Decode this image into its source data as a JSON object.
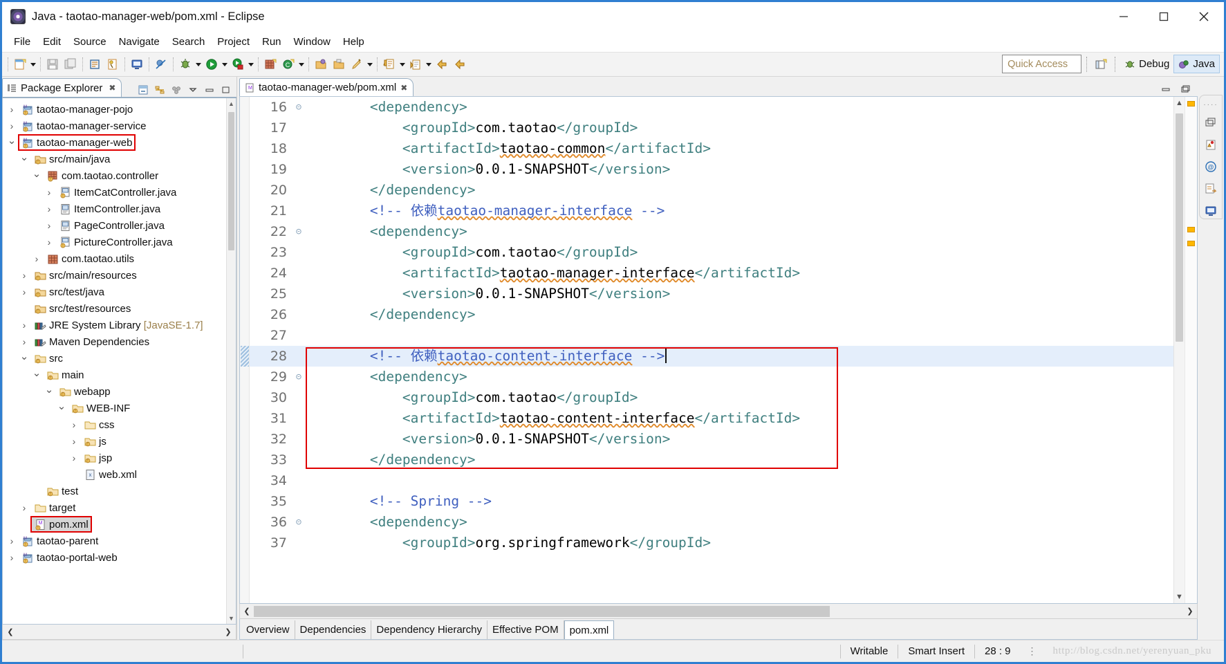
{
  "window": {
    "title": "Java - taotao-manager-web/pom.xml - Eclipse",
    "app_icon": "eclipse-icon",
    "minimize_label": "Minimize",
    "maximize_label": "Maximize",
    "close_label": "Close"
  },
  "menubar": {
    "items": [
      "File",
      "Edit",
      "Source",
      "Navigate",
      "Search",
      "Project",
      "Run",
      "Window",
      "Help"
    ]
  },
  "toolbar": {
    "quick_access_placeholder": "Quick Access",
    "perspectives": [
      {
        "label": "Debug",
        "icon": "debug-bug-icon",
        "active": false
      },
      {
        "label": "Java",
        "icon": "java-perspective-icon",
        "active": true
      }
    ],
    "open_perspective_icon": "open-perspective-icon",
    "groups": [
      {
        "icons": [
          "new-wizard-icon",
          "dropdown-caret"
        ]
      },
      {
        "icons": [
          "save-icon",
          "save-all-icon"
        ]
      },
      {
        "icons": [
          "print-icon",
          "build-all-icon"
        ]
      },
      {
        "icons": [
          "console-icon"
        ]
      },
      {
        "icons": [
          "skip-breakpoints-icon"
        ]
      },
      {
        "icons": [
          "debug-icon",
          "dropdown-caret"
        ]
      },
      {
        "icons": [
          "run-icon",
          "dropdown-caret"
        ]
      },
      {
        "icons": [
          "run-coverage-icon",
          "dropdown-caret"
        ]
      },
      {
        "icons": [
          "new-java-package-icon",
          "new-java-class-icon",
          "dropdown-caret"
        ]
      },
      {
        "icons": [
          "open-type-icon",
          "open-task-icon",
          "search-icon",
          "dropdown-caret"
        ]
      },
      {
        "icons": [
          "next-annotation-icon",
          "dropdown-caret"
        ]
      },
      {
        "icons": [
          "previous-annotation-icon",
          "dropdown-caret"
        ]
      },
      {
        "icons": [
          "back-icon",
          "forward-icon"
        ]
      }
    ]
  },
  "explorer": {
    "tab_title": "Package Explorer",
    "tab_close_icon": "close-icon",
    "tools": [
      "collapse-all-icon",
      "link-with-editor-icon",
      "view-menu-icon",
      "minimize-icon",
      "maximize-icon"
    ],
    "tree": [
      {
        "label": "taotao-manager-pojo",
        "indent": 0,
        "twist": "collapsed",
        "icon": "maven-project-icon"
      },
      {
        "label": "taotao-manager-service",
        "indent": 0,
        "twist": "collapsed",
        "icon": "maven-project-icon"
      },
      {
        "label": "taotao-manager-web",
        "indent": 0,
        "twist": "expanded",
        "icon": "maven-project-icon",
        "boxed": true
      },
      {
        "label": "src/main/java",
        "indent": 1,
        "twist": "expanded",
        "icon": "source-folder-icon"
      },
      {
        "label": "com.taotao.controller",
        "indent": 2,
        "twist": "expanded",
        "icon": "package-warn-icon"
      },
      {
        "label": "ItemCatController.java",
        "indent": 3,
        "twist": "collapsed",
        "icon": "java-file-warn-icon"
      },
      {
        "label": "ItemController.java",
        "indent": 3,
        "twist": "collapsed",
        "icon": "java-file-icon"
      },
      {
        "label": "PageController.java",
        "indent": 3,
        "twist": "collapsed",
        "icon": "java-file-icon"
      },
      {
        "label": "PictureController.java",
        "indent": 3,
        "twist": "collapsed",
        "icon": "java-file-warn-icon"
      },
      {
        "label": "com.taotao.utils",
        "indent": 2,
        "twist": "collapsed",
        "icon": "package-icon"
      },
      {
        "label": "src/main/resources",
        "indent": 1,
        "twist": "collapsed",
        "icon": "source-folder-icon"
      },
      {
        "label": "src/test/java",
        "indent": 1,
        "twist": "collapsed",
        "icon": "source-folder-icon"
      },
      {
        "label": "src/test/resources",
        "indent": 1,
        "twist": "none",
        "icon": "source-folder-icon"
      },
      {
        "label": "JRE System Library ",
        "indent": 1,
        "twist": "collapsed",
        "icon": "library-icon",
        "dim": "[JavaSE-1.7]"
      },
      {
        "label": "Maven Dependencies",
        "indent": 1,
        "twist": "collapsed",
        "icon": "library-icon"
      },
      {
        "label": "src",
        "indent": 1,
        "twist": "expanded",
        "icon": "folder-src-icon"
      },
      {
        "label": "main",
        "indent": 2,
        "twist": "expanded",
        "icon": "folder-src-icon"
      },
      {
        "label": "webapp",
        "indent": 3,
        "twist": "expanded",
        "icon": "folder-src-icon"
      },
      {
        "label": "WEB-INF",
        "indent": 4,
        "twist": "expanded",
        "icon": "folder-src-icon"
      },
      {
        "label": "css",
        "indent": 5,
        "twist": "collapsed",
        "icon": "folder-icon"
      },
      {
        "label": "js",
        "indent": 5,
        "twist": "collapsed",
        "icon": "folder-src-icon"
      },
      {
        "label": "jsp",
        "indent": 5,
        "twist": "collapsed",
        "icon": "folder-src-icon"
      },
      {
        "label": "web.xml",
        "indent": 5,
        "twist": "none",
        "icon": "xml-file-icon"
      },
      {
        "label": "test",
        "indent": 2,
        "twist": "none",
        "icon": "folder-src-icon"
      },
      {
        "label": "target",
        "indent": 1,
        "twist": "collapsed",
        "icon": "folder-icon"
      },
      {
        "label": "pom.xml",
        "indent": 1,
        "twist": "none",
        "icon": "pom-file-icon",
        "boxed": true,
        "selected": true
      },
      {
        "label": "taotao-parent",
        "indent": 0,
        "twist": "collapsed",
        "icon": "maven-project-icon"
      },
      {
        "label": "taotao-portal-web",
        "indent": 0,
        "twist": "collapsed",
        "icon": "maven-project-icon"
      }
    ]
  },
  "editor": {
    "tab_title": "taotao-manager-web/pom.xml",
    "tab_icon": "maven-pom-icon",
    "tab_close_icon": "close-icon",
    "tools": [
      "minimize-icon",
      "maximize-icon"
    ],
    "cursor_line": 28,
    "highlighted_line": 28,
    "red_box_lines": [
      28,
      33
    ],
    "lines": [
      {
        "n": 16,
        "fold": "expanded",
        "segs": [
          {
            "t": "tag",
            "v": "        <dependency>"
          }
        ]
      },
      {
        "n": 17,
        "fold": "",
        "segs": [
          {
            "t": "tag",
            "v": "            <groupId>"
          },
          {
            "t": "txt",
            "v": "com.taotao"
          },
          {
            "t": "tag",
            "v": "</groupId>"
          }
        ]
      },
      {
        "n": 18,
        "fold": "",
        "segs": [
          {
            "t": "tag",
            "v": "            <artifactId>"
          },
          {
            "t": "sq",
            "v": "taotao-common"
          },
          {
            "t": "tag",
            "v": "</artifactId>"
          }
        ]
      },
      {
        "n": 19,
        "fold": "",
        "segs": [
          {
            "t": "tag",
            "v": "            <version>"
          },
          {
            "t": "txt",
            "v": "0.0.1-SNAPSHOT"
          },
          {
            "t": "tag",
            "v": "</version>"
          }
        ]
      },
      {
        "n": 20,
        "fold": "",
        "segs": [
          {
            "t": "tag",
            "v": "        </dependency>"
          }
        ]
      },
      {
        "n": 21,
        "fold": "",
        "segs": [
          {
            "t": "cmt",
            "v": "        <!-- 依赖"
          },
          {
            "t": "cmtsq",
            "v": "taotao-manager-interface"
          },
          {
            "t": "cmt",
            "v": " -->"
          }
        ]
      },
      {
        "n": 22,
        "fold": "expanded",
        "segs": [
          {
            "t": "tag",
            "v": "        <dependency>"
          }
        ]
      },
      {
        "n": 23,
        "fold": "",
        "segs": [
          {
            "t": "tag",
            "v": "            <groupId>"
          },
          {
            "t": "txt",
            "v": "com.taotao"
          },
          {
            "t": "tag",
            "v": "</groupId>"
          }
        ]
      },
      {
        "n": 24,
        "fold": "",
        "segs": [
          {
            "t": "tag",
            "v": "            <artifactId>"
          },
          {
            "t": "sq",
            "v": "taotao-manager-interface"
          },
          {
            "t": "tag",
            "v": "</artifactId>"
          }
        ]
      },
      {
        "n": 25,
        "fold": "",
        "segs": [
          {
            "t": "tag",
            "v": "            <version>"
          },
          {
            "t": "txt",
            "v": "0.0.1-SNAPSHOT"
          },
          {
            "t": "tag",
            "v": "</version>"
          }
        ]
      },
      {
        "n": 26,
        "fold": "",
        "segs": [
          {
            "t": "tag",
            "v": "        </dependency>"
          }
        ]
      },
      {
        "n": 27,
        "fold": "",
        "segs": [
          {
            "t": "txt",
            "v": ""
          }
        ]
      },
      {
        "n": 28,
        "fold": "",
        "segs": [
          {
            "t": "cmt",
            "v": "        <!-- 依赖"
          },
          {
            "t": "cmtsq",
            "v": "taotao-content-interface"
          },
          {
            "t": "cmt",
            "v": " -->"
          },
          {
            "t": "caret",
            "v": ""
          }
        ]
      },
      {
        "n": 29,
        "fold": "expanded",
        "segs": [
          {
            "t": "tag",
            "v": "        <dependency>"
          }
        ]
      },
      {
        "n": 30,
        "fold": "",
        "segs": [
          {
            "t": "tag",
            "v": "            <groupId>"
          },
          {
            "t": "txt",
            "v": "com.taotao"
          },
          {
            "t": "tag",
            "v": "</groupId>"
          }
        ]
      },
      {
        "n": 31,
        "fold": "",
        "segs": [
          {
            "t": "tag",
            "v": "            <artifactId>"
          },
          {
            "t": "sq",
            "v": "taotao-content-interface"
          },
          {
            "t": "tag",
            "v": "</artifactId>"
          }
        ]
      },
      {
        "n": 32,
        "fold": "",
        "segs": [
          {
            "t": "tag",
            "v": "            <version>"
          },
          {
            "t": "txt",
            "v": "0.0.1-SNAPSHOT"
          },
          {
            "t": "tag",
            "v": "</version>"
          }
        ]
      },
      {
        "n": 33,
        "fold": "",
        "segs": [
          {
            "t": "tag",
            "v": "        </dependency>"
          }
        ]
      },
      {
        "n": 34,
        "fold": "",
        "segs": [
          {
            "t": "txt",
            "v": ""
          }
        ]
      },
      {
        "n": 35,
        "fold": "",
        "segs": [
          {
            "t": "cmt",
            "v": "        <!-- Spring -->"
          }
        ]
      },
      {
        "n": 36,
        "fold": "expanded",
        "segs": [
          {
            "t": "tag",
            "v": "        <dependency>"
          }
        ]
      },
      {
        "n": 37,
        "fold": "",
        "segs": [
          {
            "t": "tag",
            "v": "            <groupId>"
          },
          {
            "t": "txt",
            "v": "org.springframework"
          },
          {
            "t": "tag",
            "v": "</groupId>"
          }
        ]
      }
    ],
    "page_tabs": [
      {
        "label": "Overview",
        "active": false
      },
      {
        "label": "Dependencies",
        "active": false
      },
      {
        "label": "Dependency Hierarchy",
        "active": false
      },
      {
        "label": "Effective POM",
        "active": false
      },
      {
        "label": "pom.xml",
        "active": true
      }
    ]
  },
  "fastview": {
    "icons": [
      "restore-icon",
      "problems-icon",
      "javadoc-icon",
      "declaration-icon",
      "console-icon"
    ]
  },
  "statusbar": {
    "writable": "Writable",
    "insert_mode": "Smart Insert",
    "position": "28 : 9",
    "watermark": "http://blog.csdn.net/yerenyuan_pku"
  },
  "colors": {
    "tag": "#3f7f7f",
    "comment": "#3f5fbf",
    "text": "#000000",
    "highlight_line": "#e4eefb",
    "red_box": "#e00000",
    "accent": "#2f7fd1"
  }
}
